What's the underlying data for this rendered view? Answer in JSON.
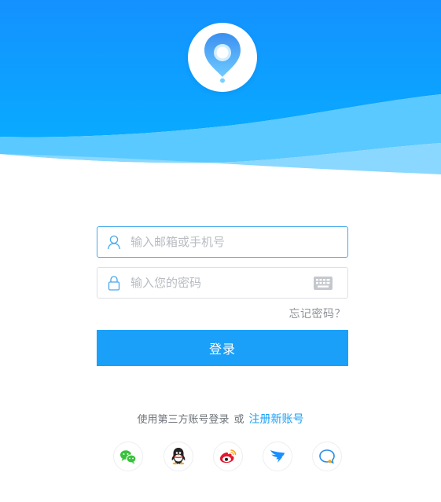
{
  "colors": {
    "primary": "#1aa0f8",
    "header_top": "#1491ff",
    "header_bottom": "#09aaff",
    "wave_light": "#5ac9ff",
    "wave_lighter": "#8ad8ff",
    "input_border_active": "#46a8ee",
    "input_border": "#dcdfe4",
    "placeholder": "#b8bcc2",
    "link": "#1aa0f8"
  },
  "icons": {
    "logo": "map-pin-icon",
    "email": "user-icon",
    "password": "lock-icon",
    "keyboard": "keyboard-icon"
  },
  "login": {
    "email_placeholder": "输入邮箱或手机号",
    "email_value": "",
    "password_placeholder": "输入您的密码",
    "password_value": "",
    "forgot_label": "忘记密码？",
    "submit_label": "登录"
  },
  "third_party": {
    "prefix": "使用第三方账号登录",
    "or": "或",
    "register_label": "注册新账号",
    "providers": [
      {
        "name": "wechat",
        "icon": "wechat-icon"
      },
      {
        "name": "qq",
        "icon": "qq-icon"
      },
      {
        "name": "weibo",
        "icon": "weibo-icon"
      },
      {
        "name": "dingtalk",
        "icon": "dingtalk-icon"
      },
      {
        "name": "feedback",
        "icon": "chat-bubble-icon"
      }
    ]
  }
}
